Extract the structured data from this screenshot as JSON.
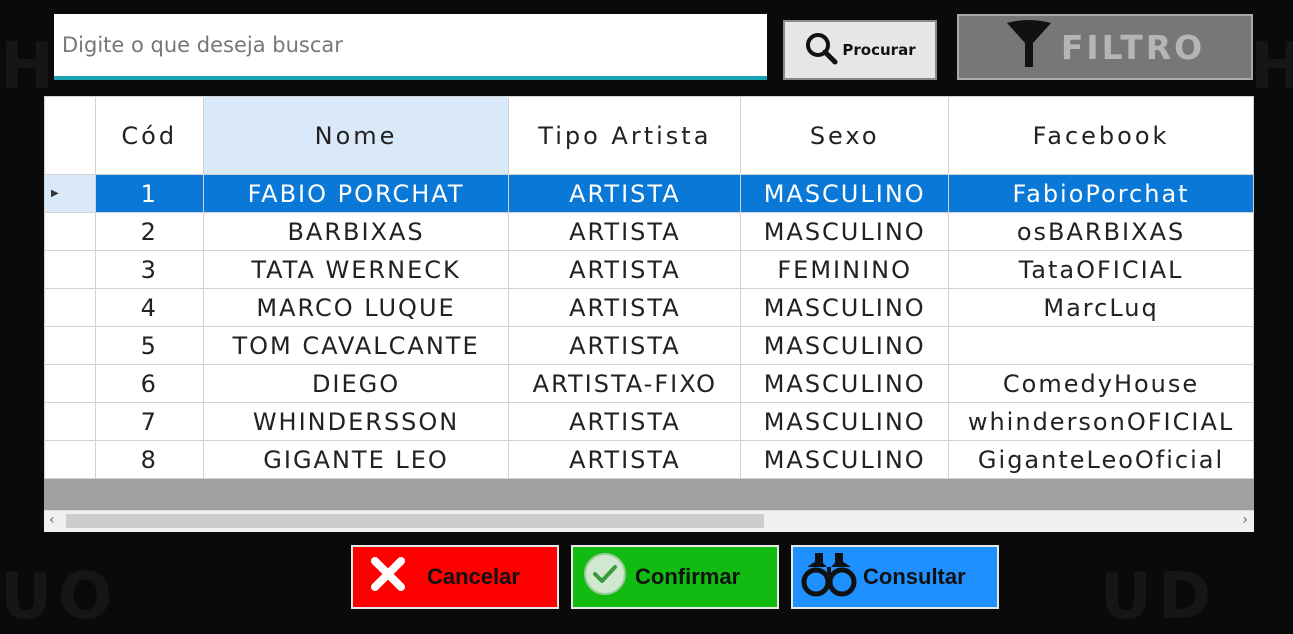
{
  "search": {
    "placeholder": "Digite o que deseja buscar",
    "button_label": "Procurar"
  },
  "filter": {
    "label": "FILTRO"
  },
  "table": {
    "columns": [
      "Cód",
      "Nome",
      "Tipo Artista",
      "Sexo",
      "Facebook"
    ],
    "rows": [
      [
        "1",
        "FABIO PORCHAT",
        "ARTISTA",
        "MASCULINO",
        "FabioPorchat"
      ],
      [
        "2",
        "BARBIXAS",
        "ARTISTA",
        "MASCULINO",
        "osBARBIXAS"
      ],
      [
        "3",
        "TATA WERNECK",
        "ARTISTA",
        "FEMININO",
        "TataOFICIAL"
      ],
      [
        "4",
        "MARCO LUQUE",
        "ARTISTA",
        "MASCULINO",
        "MarcLuq"
      ],
      [
        "5",
        "TOM CAVALCANTE",
        "ARTISTA",
        "MASCULINO",
        ""
      ],
      [
        "6",
        "DIEGO",
        "ARTISTA-FIXO",
        "MASCULINO",
        "ComedyHouse"
      ],
      [
        "7",
        "WHINDERSSON",
        "ARTISTA",
        "MASCULINO",
        "whindersonOFICIAL"
      ],
      [
        "8",
        "GIGANTE LEO",
        "ARTISTA",
        "MASCULINO",
        "GiganteLeoOficial"
      ]
    ],
    "selected_row": 0
  },
  "actions": {
    "cancel": "Cancelar",
    "confirm": "Confirmar",
    "consult": "Consultar"
  },
  "colors": {
    "cancel": "#ff0000",
    "confirm": "#11bb11",
    "consult": "#1e90ff",
    "selection": "#0a78d7",
    "accent": "#1aa3b5"
  },
  "icons": {
    "search": "magnifier-icon",
    "filter": "funnel-icon",
    "cancel": "x-icon",
    "confirm": "check-circle-icon",
    "consult": "binoculars-icon"
  }
}
